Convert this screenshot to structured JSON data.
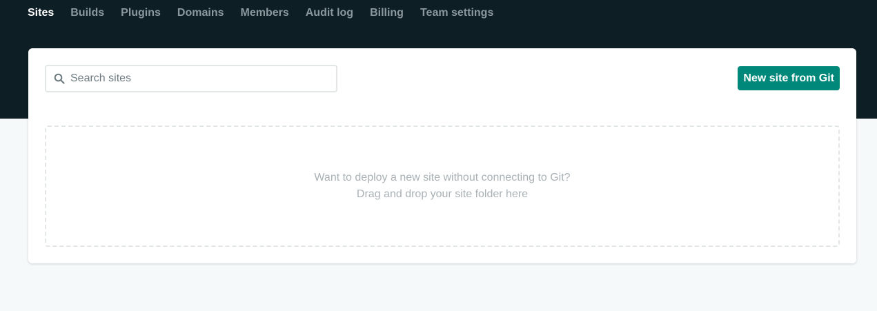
{
  "nav": {
    "items": [
      {
        "label": "Sites",
        "active": true
      },
      {
        "label": "Builds",
        "active": false
      },
      {
        "label": "Plugins",
        "active": false
      },
      {
        "label": "Domains",
        "active": false
      },
      {
        "label": "Members",
        "active": false
      },
      {
        "label": "Audit log",
        "active": false
      },
      {
        "label": "Billing",
        "active": false
      },
      {
        "label": "Team settings",
        "active": false
      }
    ]
  },
  "search": {
    "placeholder": "Search sites",
    "value": "",
    "icon": "search-icon"
  },
  "actions": {
    "new_site_label": "New site from Git"
  },
  "dropzone": {
    "line1": "Want to deploy a new site without connecting to Git?",
    "line2": "Drag and drop your site folder here"
  },
  "colors": {
    "header_bg": "#0e1e25",
    "accent": "#00897b",
    "nav_inactive": "#8a989e",
    "nav_active": "#ffffff"
  }
}
